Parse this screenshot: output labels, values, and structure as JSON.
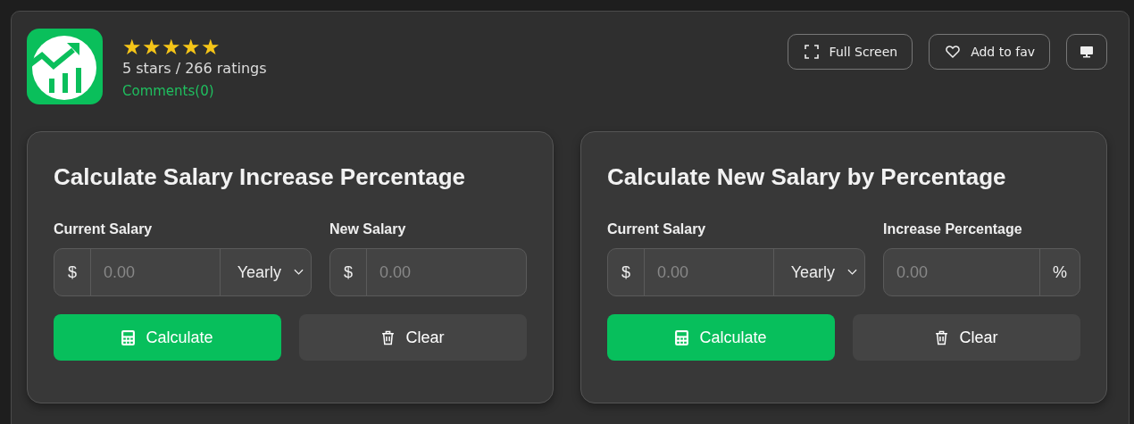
{
  "header": {
    "stars": 5,
    "rating_text": "5 stars / 266 ratings",
    "comments_link": "Comments(0)"
  },
  "actions": [
    {
      "kind": "fullscreen",
      "label": "Full Screen"
    },
    {
      "kind": "favorite",
      "label": "Add to fav"
    },
    {
      "kind": "display"
    }
  ],
  "cards": [
    {
      "title": "Calculate Salary Increase Percentage",
      "fields": [
        {
          "label": "Current Salary",
          "prefix": "$",
          "placeholder": "0.00",
          "period": "Yearly"
        },
        {
          "label": "New Salary",
          "prefix": "$",
          "placeholder": "0.00"
        }
      ],
      "buttons": [
        {
          "kind": "calculate",
          "label": "Calculate"
        },
        {
          "kind": "clear",
          "label": "Clear"
        }
      ]
    },
    {
      "title": "Calculate New Salary by Percentage",
      "fields": [
        {
          "label": "Current Salary",
          "prefix": "$",
          "placeholder": "0.00",
          "period": "Yearly"
        },
        {
          "label": "Increase Percentage",
          "placeholder": "0.00",
          "suffix": "%"
        }
      ],
      "buttons": [
        {
          "kind": "calculate",
          "label": "Calculate"
        },
        {
          "kind": "clear",
          "label": "Clear"
        }
      ]
    }
  ]
}
